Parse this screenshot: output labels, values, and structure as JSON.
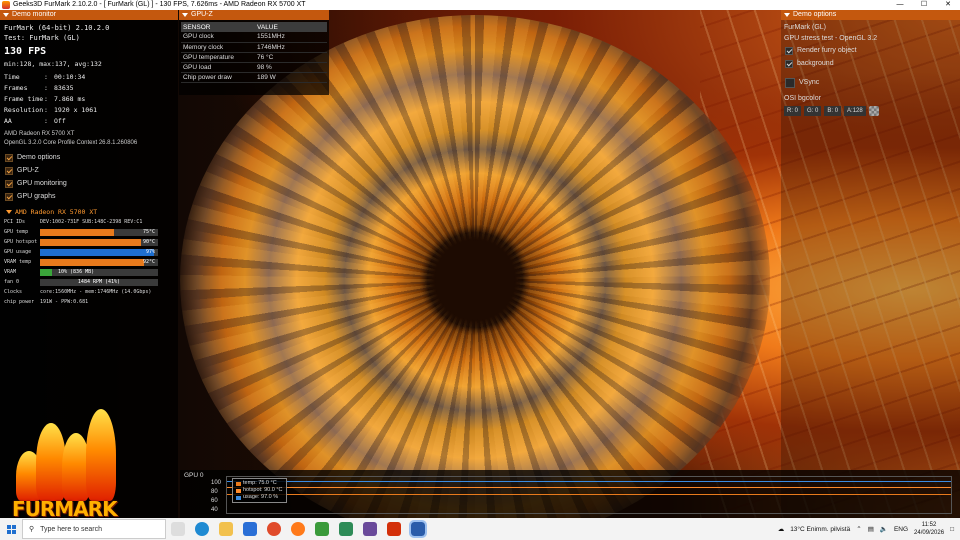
{
  "window": {
    "title": "Geeks3D FurMark 2.10.2.0 - [ FurMark (GL) ] - 130 FPS, 7.626ms - AMD Radeon RX 5700 XT",
    "min_icon": "—",
    "max_icon": "☐",
    "close_icon": "✕"
  },
  "demo_monitor": {
    "header": "Demo monitor",
    "line1": "FurMark (64-bit) 2.10.2.0",
    "line2": "Test: FurMark (GL)",
    "fps": "130 FPS",
    "fps_stats": "min:128, max:137, avg:132",
    "stats": [
      {
        "k": "Time",
        "v": "00:10:34"
      },
      {
        "k": "Frames",
        "v": "83635"
      },
      {
        "k": "Frame time",
        "v": "7.868 ms"
      },
      {
        "k": "Resolution",
        "v": "1920 x 1061"
      },
      {
        "k": "AA",
        "v": "Off"
      }
    ],
    "gpu_name": "AMD Radeon RX 5700 XT",
    "gl_info": "OpenGL 3.2.0 Core Profile Context 26.8.1.260806",
    "checks": [
      {
        "label": "Demo options",
        "checked": true
      },
      {
        "label": "GPU-Z",
        "checked": true
      },
      {
        "label": "GPU monitoring",
        "checked": true
      },
      {
        "label": "GPU graphs",
        "checked": true
      }
    ],
    "gpu_section_title": "AMD Radeon RX 5700 XT",
    "pci_label": "PCI IDs",
    "pci_value": "DEV:1002-731F SUB:148C-2398 REV:C1",
    "bars": [
      {
        "label": "GPU temp",
        "value": "75°C",
        "fraction": 0.63,
        "color": "orange"
      },
      {
        "label": "GPU hotspot",
        "value": "90°C",
        "fraction": 0.86,
        "color": "orange"
      },
      {
        "label": "GPU usage",
        "value": "97%",
        "fraction": 0.97,
        "color": "blue"
      },
      {
        "label": "VRAM temp",
        "value": "92°C",
        "fraction": 0.88,
        "color": "orange"
      },
      {
        "label": "VRAM",
        "value": "10% (836 MB)",
        "fraction": 0.1,
        "color": "green"
      },
      {
        "label": "fan 0",
        "value": "1484 RPM (41%)",
        "fraction": 0.41,
        "color": "none"
      }
    ],
    "clocks_label": "Clocks",
    "clocks_value": "core:1560MHz - mem:1746MHz (14.0Gbps)",
    "power_label": "chip power",
    "power_value": "191W - PPW:0.681",
    "logo_word": "FURMARK"
  },
  "gpuz": {
    "header": "GPU-Z",
    "col_sensor": "SENSOR",
    "col_value": "VALUE",
    "rows": [
      {
        "sensor": "GPU clock",
        "value": "1551MHz"
      },
      {
        "sensor": "Memory clock",
        "value": "1746MHz"
      },
      {
        "sensor": "GPU temperature",
        "value": "76 °C"
      },
      {
        "sensor": "GPU load",
        "value": "98 %"
      },
      {
        "sensor": "Chip power draw",
        "value": "189 W"
      }
    ]
  },
  "demo_options": {
    "header": "Demo options",
    "title": "FurMark (GL)",
    "subtitle": "GPU stress test - OpenGL 3.2",
    "render_furry_label": "Render furry object",
    "background_label": "background",
    "vsync_label": "VSync",
    "osi_label": "OSI bgcolor",
    "r": "R: 0",
    "g": "G: 0",
    "b": "B: 0",
    "a": "A:128"
  },
  "graph": {
    "label": "GPU 0",
    "yticks": [
      "100",
      "80",
      "60",
      "40"
    ],
    "legend": [
      {
        "text": "temp: 75.0 °C",
        "color": "#e87a1c"
      },
      {
        "text": "hotspot: 90.0 °C",
        "color": "#ff8a2a"
      },
      {
        "text": "usage: 97.0 %",
        "color": "#3a8be0"
      }
    ]
  },
  "taskbar": {
    "search_placeholder": "Type here to search",
    "weather": "13°C  Enimm. pilvistä",
    "lang": "ENG",
    "time": "11:52",
    "date": "24/09/2026"
  }
}
